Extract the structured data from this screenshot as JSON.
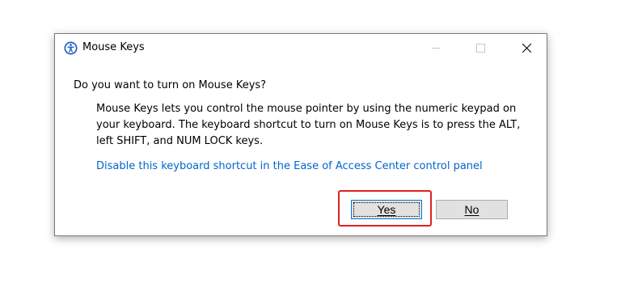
{
  "window": {
    "title": "Mouse Keys",
    "icon": "ease-of-access-icon",
    "controls": {
      "minimize": "minimize-icon",
      "maximize": "maximize-icon",
      "close": "close-icon"
    }
  },
  "content": {
    "question": "Do you want to turn on Mouse Keys?",
    "description": "Mouse Keys lets you control the mouse pointer by using the numeric keypad on your keyboard.  The keyboard shortcut to turn on Mouse Keys is to press the ALT, left SHIFT, and NUM LOCK keys.",
    "link": "Disable this keyboard shortcut in the Ease of Access Center control panel"
  },
  "buttons": {
    "yes": "Yes",
    "no": "No"
  },
  "colors": {
    "link": "#0066cc",
    "highlight": "#e02020",
    "button_face": "#e1e1e1",
    "default_button_border": "#0078d7"
  }
}
